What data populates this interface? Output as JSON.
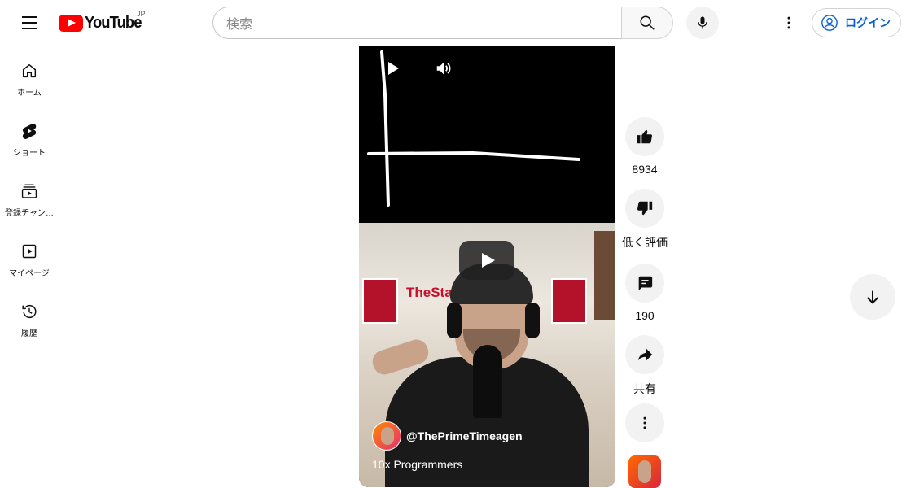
{
  "header": {
    "logo_text": "YouTube",
    "region": "JP",
    "search_placeholder": "検索",
    "login_label": "ログイン"
  },
  "sidebar": {
    "items": [
      {
        "label": "ホーム",
        "icon": "home-icon"
      },
      {
        "label": "ショート",
        "icon": "shorts-icon"
      },
      {
        "label": "登録チャン…",
        "icon": "subscriptions-icon"
      },
      {
        "label": "マイページ",
        "icon": "library-icon"
      },
      {
        "label": "履歴",
        "icon": "history-icon"
      }
    ]
  },
  "video": {
    "channel": "@ThePrimeTimeagen",
    "title": "10x Programmers",
    "background_text": "TheSta"
  },
  "actions": {
    "like_count": "8934",
    "dislike_label": "低く評価",
    "comment_count": "190",
    "share_label": "共有"
  },
  "colors": {
    "brand_red": "#ff0000",
    "link_blue": "#065fd4",
    "action_bg": "#f2f2f2"
  }
}
